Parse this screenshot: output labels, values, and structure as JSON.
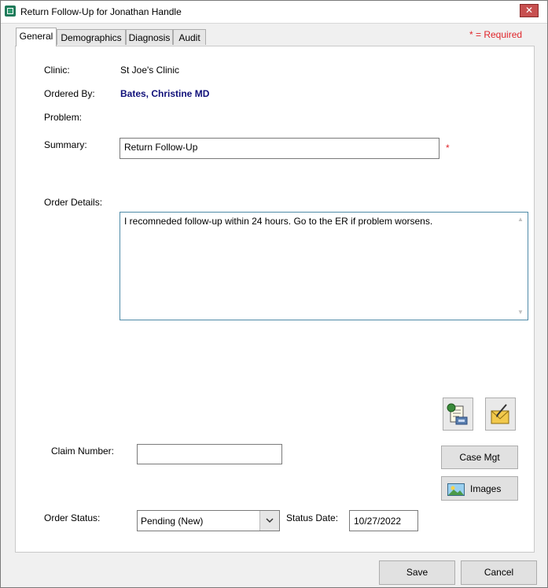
{
  "window": {
    "title": "Return Follow-Up for Jonathan Handle",
    "close_label": "✕"
  },
  "tabs": [
    {
      "label": "General",
      "active": true
    },
    {
      "label": "Demographics",
      "active": false
    },
    {
      "label": "Diagnosis",
      "active": false
    },
    {
      "label": "Audit",
      "active": false
    }
  ],
  "required_note": "* = Required",
  "fields": {
    "clinic_label": "Clinic:",
    "clinic_value": "St Joe's Clinic",
    "ordered_by_label": "Ordered By:",
    "ordered_by_value": "Bates, Christine  MD",
    "problem_label": "Problem:",
    "summary_label": "Summary:",
    "summary_value": "Return Follow-Up",
    "required_marker": "*",
    "order_details_label": "Order Details:",
    "order_details_value": "I recomneded follow-up within 24 hours. Go to the ER if problem worsens.",
    "claim_number_label": "Claim Number:",
    "claim_number_value": "",
    "order_status_label": "Order Status:",
    "order_status_value": "Pending (New)",
    "status_date_label": "Status Date:",
    "status_date_value": "10/27/2022"
  },
  "buttons": {
    "case_mgt": "Case Mgt",
    "images": "Images",
    "save": "Save",
    "cancel": "Cancel"
  },
  "colors": {
    "accent_blue": "#10107a",
    "required_red": "#e0252b",
    "focus_border": "#4f8ba8"
  }
}
